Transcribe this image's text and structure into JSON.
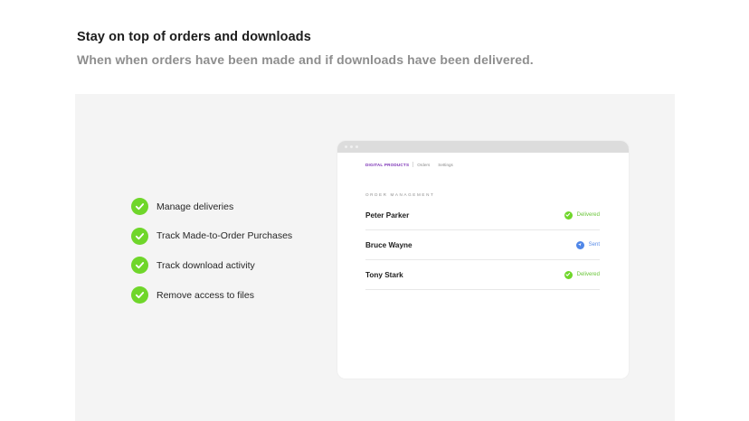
{
  "header": {
    "title": "Stay on top of orders and downloads",
    "subtitle": "When when orders have been made and if downloads have been delivered."
  },
  "features": [
    {
      "label": "Manage deliveries",
      "icon": "check-circle-icon"
    },
    {
      "label": "Track Made-to-Order Purchases",
      "icon": "check-circle-icon"
    },
    {
      "label": "Track download activity",
      "icon": "check-circle-icon"
    },
    {
      "label": "Remove access to files",
      "icon": "check-circle-icon"
    }
  ],
  "app": {
    "nav": {
      "brand": "DIGITAL PRODUCTS",
      "items": [
        "Orders",
        "Settings"
      ]
    },
    "section_label": "ORDER MANAGEMENT",
    "orders": [
      {
        "name": "Peter Parker",
        "status": "Delivered",
        "status_icon": "check-circle-icon"
      },
      {
        "name": "Bruce Wayne",
        "status": "Sent",
        "status_icon": "send-icon"
      },
      {
        "name": "Tony Stark",
        "status": "Delivered",
        "status_icon": "check-circle-icon"
      }
    ]
  },
  "colors": {
    "check_green": "#6fd62a",
    "delivered_text": "#6bc63a",
    "sent_blue": "#4f86e8",
    "brand_purple": "#7a2fb5",
    "panel_bg": "#f4f4f4"
  }
}
